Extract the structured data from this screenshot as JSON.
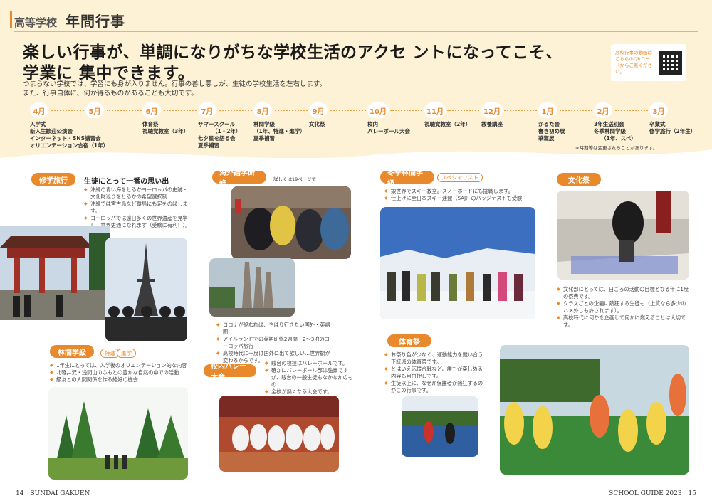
{
  "header": {
    "sub": "高等学校",
    "main": "年間行事"
  },
  "headline": {
    "line1": "楽しい行事が、単調になりがちな学校生活のアクセ ントになってこそ、",
    "line2": "学業に 集中できます。"
  },
  "lead": {
    "line1": "つまらない学校では、学習にも身が入りません。行事の善し悪しが、生徒の学校生活を左右します。",
    "line2": "また、行事自体に、何か得るものがあることも大切です。"
  },
  "qr": {
    "text": "高校行事の動画はこちらのQRコードからご覧ください。"
  },
  "timeline": {
    "months": [
      "4月",
      "5月",
      "6月",
      "7月",
      "8月",
      "9月",
      "10月",
      "11月",
      "12月",
      "1月",
      "2月",
      "3月"
    ],
    "events": [
      [
        "入学式",
        "新入生歓迎公演会",
        "インターネット・SNS講習会",
        "オリエンテーション合宿（1年）"
      ],
      [],
      [
        "体育祭",
        "視聴覚教室（3年）"
      ],
      [
        "サマースクール",
        "（1・2年）",
        "七夕星を語る会",
        "夏季補習"
      ],
      [
        "林間学級",
        "（1年、特進・進学）",
        "夏季補習"
      ],
      [
        "文化祭"
      ],
      [
        "校内",
        "バレーボール大会"
      ],
      [
        "視聴覚教室（2年）"
      ],
      [
        "教養講座"
      ],
      [
        "かるた会",
        "書き初め展",
        "華道展"
      ],
      [
        "3年生送別会",
        "冬季林間学級",
        "（1年、スペ）"
      ],
      [
        "卒業式",
        "修学旅行（2年生）"
      ]
    ],
    "note": "※時期等は変更されることがあります。"
  },
  "sections": {
    "trip": {
      "label": "修学旅行",
      "subtitle": "生徒にとって一番の思い出",
      "bullets": [
        "沖縄の青い海をとるかヨーロッパの史跡・文化財巡りをとるかの希望選択制",
        "沖縄では宮古島など離島にも足をのばします。",
        "ヨーロッパでは遠日多くの世界遺産を見学し、世界史通になれます（受験に有利！）。"
      ]
    },
    "abroad": {
      "label": "海外語学研修",
      "note": "詳しくは19ページで",
      "bullets": [
        "コロナが終われば、やはり行きたい国外・英語圏",
        "アイルランドでの英語研修2週間＋2〜3泊のヨーロッパ旅行",
        "高校時代に一度は国外に出て欲しい…世界観が変わるからです。"
      ]
    },
    "winter": {
      "label": "冬季林間学級",
      "tag": "スペシャリスト",
      "bullets": [
        "銀世界でスキー教室。スノーボードにも挑戦します。",
        "仕上げに全日本スキー連盟（SAJ）のバッジテストも受験"
      ]
    },
    "culture": {
      "label": "文化祭",
      "bullets": [
        "文化部にとっては、日ごろの活動の目標となる年に1度の祭典です。",
        "クラスごとの企画に熱狂する生徒も（上質なら多少のハメ外しも許されます）。",
        "高校時代に何かを企画して何かに燃えることは大切です。"
      ]
    },
    "camp": {
      "label": "林間学級",
      "tag1": "特進",
      "tag2": "進学",
      "bullets": [
        "1年生にとっては、入学後のオリエンテーション的な内容",
        "北軽井沢・浅間山のふもとの豊かな自然の中での活動",
        "級友との人間関係を作る絶好の機会"
      ]
    },
    "volley": {
      "label": "校内バレー大会",
      "bullets": [
        "駿台の校技はバレーボールです。",
        "確かにバレーボール部は強豪ですが、駿台の一般生徒もなかなかのもの",
        "全校が熱くなる大会です。"
      ]
    },
    "sports": {
      "label": "体育祭",
      "bullets": [
        "お祭り色が少なく、運動能力を競い合う正統派の体育祭です。",
        "とはいえ応援合戦など、誰もが楽しめる内容も目白押しです。",
        "生徒以上に、なぜか保護者が熱狂するのがこの行事です。"
      ]
    }
  },
  "footer": {
    "left": "14　SUNDAI GAKUEN",
    "right": "SCHOOL GUIDE 2023　15"
  }
}
